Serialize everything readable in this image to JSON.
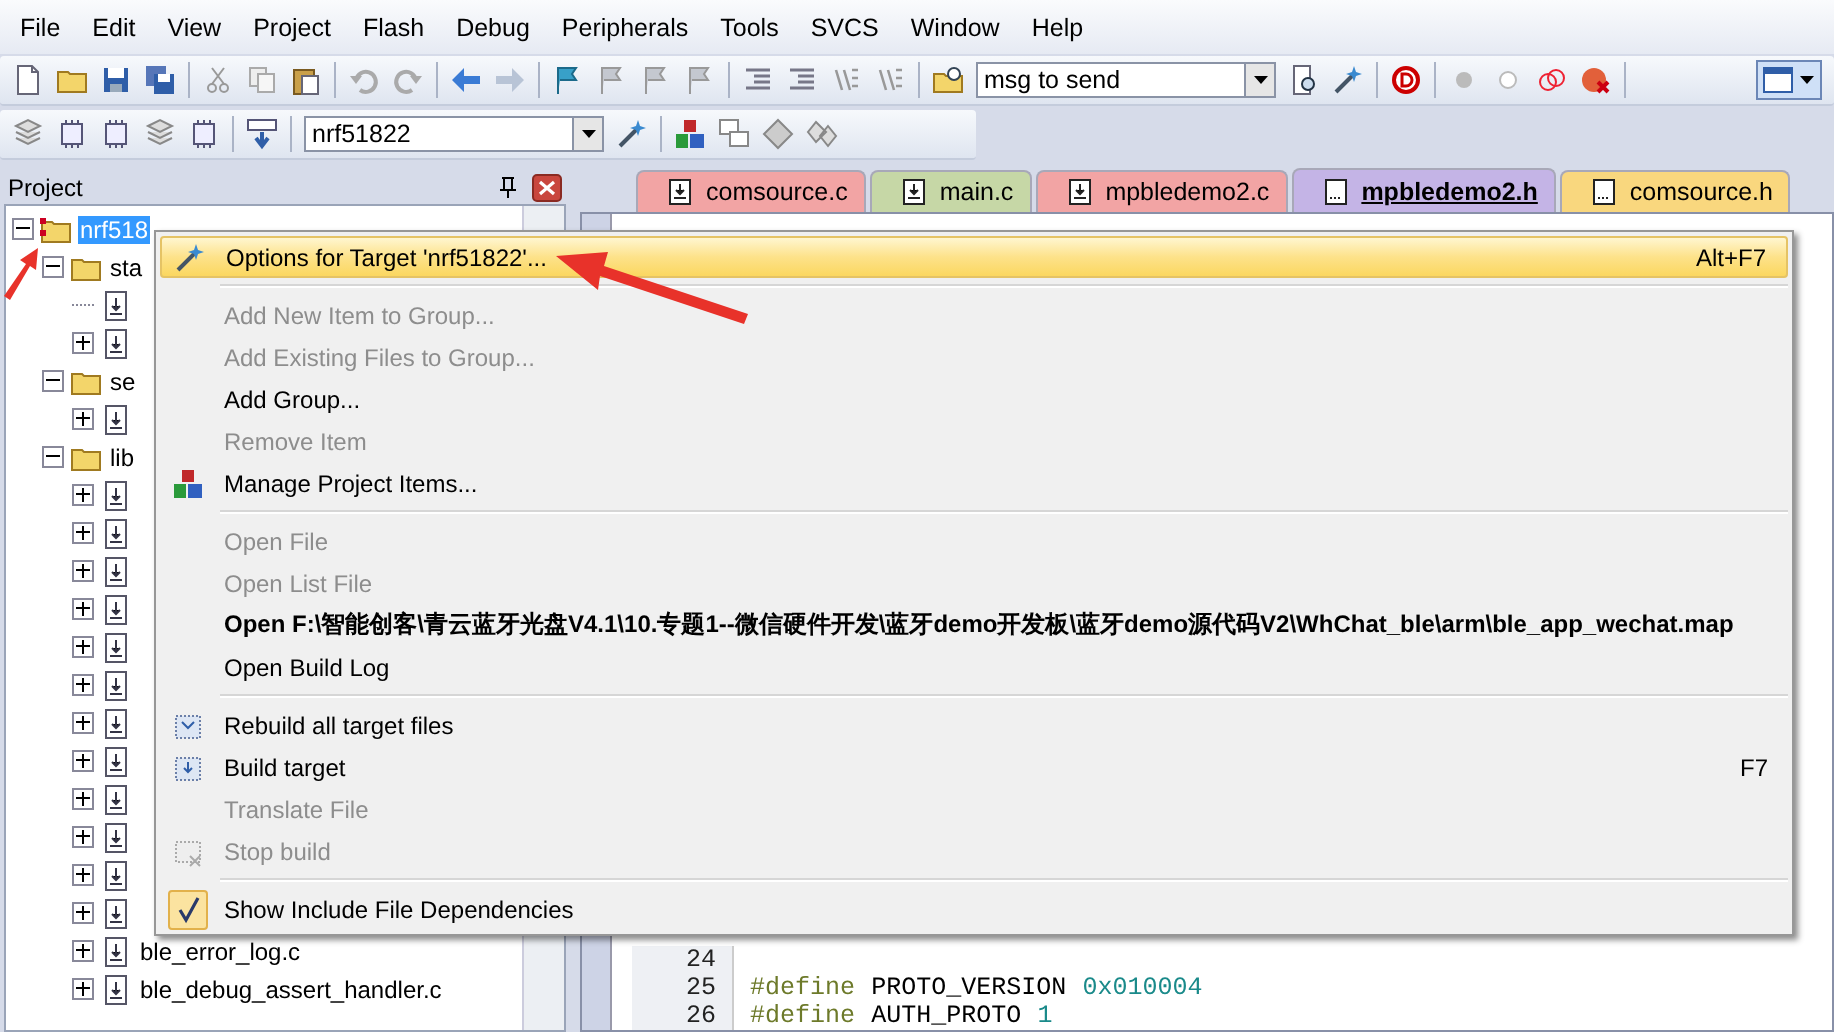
{
  "menubar": [
    "File",
    "Edit",
    "View",
    "Project",
    "Flash",
    "Debug",
    "Peripherals",
    "Tools",
    "SVCS",
    "Window",
    "Help"
  ],
  "toolbar": {
    "find_combo": "msg to send",
    "target_combo": "nrf51822"
  },
  "project_panel": {
    "title": "Project",
    "tree": [
      {
        "kind": "target",
        "label": "nrf518",
        "selected": true,
        "expanded": true,
        "children": [
          {
            "kind": "group",
            "label": "sta",
            "expanded": true,
            "children": [
              {
                "kind": "leaf"
              },
              {
                "kind": "file",
                "expanded": false
              }
            ]
          },
          {
            "kind": "group",
            "label": "se",
            "expanded": true,
            "children": [
              {
                "kind": "file",
                "expanded": false
              }
            ]
          },
          {
            "kind": "group",
            "label": "lib",
            "expanded": true,
            "children": [
              {
                "kind": "file",
                "expanded": false
              },
              {
                "kind": "file",
                "expanded": false
              },
              {
                "kind": "file",
                "expanded": false
              },
              {
                "kind": "file",
                "expanded": false
              },
              {
                "kind": "file",
                "expanded": false
              },
              {
                "kind": "file",
                "expanded": false
              },
              {
                "kind": "file",
                "expanded": false
              },
              {
                "kind": "file",
                "expanded": false
              },
              {
                "kind": "file",
                "expanded": false
              },
              {
                "kind": "file",
                "expanded": false
              },
              {
                "kind": "file",
                "expanded": false
              },
              {
                "kind": "file",
                "expanded": false
              },
              {
                "kind": "file",
                "label": "ble_error_log.c",
                "expanded": false
              },
              {
                "kind": "file",
                "label": "ble_debug_assert_handler.c",
                "expanded": false
              }
            ]
          }
        ]
      }
    ]
  },
  "editor": {
    "tabs": [
      {
        "label": "comsource.c",
        "kind": "source",
        "color": "#f2a4a4",
        "selected": false
      },
      {
        "label": "main.c",
        "kind": "source",
        "color": "#c6d7a6",
        "selected": false
      },
      {
        "label": "mpbledemo2.c",
        "kind": "source",
        "color": "#f2a4a4",
        "selected": false
      },
      {
        "label": "mpbledemo2.h",
        "kind": "header",
        "color": "#c4b4e6",
        "selected": true
      },
      {
        "label": "comsource.h",
        "kind": "header",
        "color": "#f9d77e",
        "selected": false
      }
    ],
    "lines": [
      {
        "number": "24"
      },
      {
        "number": "25",
        "tokens": [
          {
            "kind": "directive",
            "text": "#define"
          },
          {
            "kind": "name",
            "text": "PROTO_VERSION"
          },
          {
            "kind": "number",
            "text": "0x010004"
          }
        ]
      },
      {
        "number": "26",
        "tokens": [
          {
            "kind": "directive",
            "text": "#define"
          },
          {
            "kind": "name",
            "text": "AUTH_PROTO"
          },
          {
            "kind": "number",
            "text": "1"
          }
        ]
      }
    ]
  },
  "context_menu": [
    {
      "kind": "command",
      "label": "Options for Target 'nrf51822'...",
      "shortcut": "Alt+F7",
      "enabled": true,
      "selected": true,
      "default": false
    },
    {
      "kind": "separator"
    },
    {
      "kind": "command",
      "label": "Add New Item to Group...",
      "enabled": false,
      "selected": false,
      "default": false
    },
    {
      "kind": "command",
      "label": "Add Existing Files to Group...",
      "enabled": false,
      "selected": false,
      "default": false
    },
    {
      "kind": "command",
      "label": "Add Group...",
      "enabled": true,
      "selected": false,
      "default": false
    },
    {
      "kind": "command",
      "label": "Remove Item",
      "enabled": false,
      "selected": false,
      "default": false
    },
    {
      "kind": "command",
      "label": "Manage Project Items...",
      "enabled": true,
      "selected": false,
      "default": false
    },
    {
      "kind": "separator"
    },
    {
      "kind": "command",
      "label": "Open File",
      "enabled": false,
      "selected": false,
      "default": false
    },
    {
      "kind": "command",
      "label": "Open List File",
      "enabled": false,
      "selected": false,
      "default": false
    },
    {
      "kind": "command",
      "label": "Open F:\\智能创客\\青云蓝牙光盘V4.1\\10.专题1--微信硬件开发\\蓝牙demo开发板\\蓝牙demo源代码V2\\WhChat_ble\\arm\\ble_app_wechat.map",
      "enabled": true,
      "selected": false,
      "default": true
    },
    {
      "kind": "command",
      "label": "Open Build Log",
      "enabled": true,
      "selected": false,
      "default": false
    },
    {
      "kind": "separator"
    },
    {
      "kind": "command",
      "label": "Rebuild all target files",
      "enabled": true,
      "selected": false,
      "default": false
    },
    {
      "kind": "command",
      "label": "Build target",
      "shortcut": "F7",
      "enabled": true,
      "selected": false,
      "default": false
    },
    {
      "kind": "command",
      "label": "Translate File",
      "enabled": false,
      "selected": false,
      "default": false
    },
    {
      "kind": "command",
      "label": "Stop build",
      "enabled": false,
      "selected": false,
      "default": false
    },
    {
      "kind": "separator"
    },
    {
      "kind": "toggle",
      "label": "Show Include File Dependencies",
      "checked": true,
      "enabled": true,
      "selected": false,
      "default": false
    }
  ]
}
